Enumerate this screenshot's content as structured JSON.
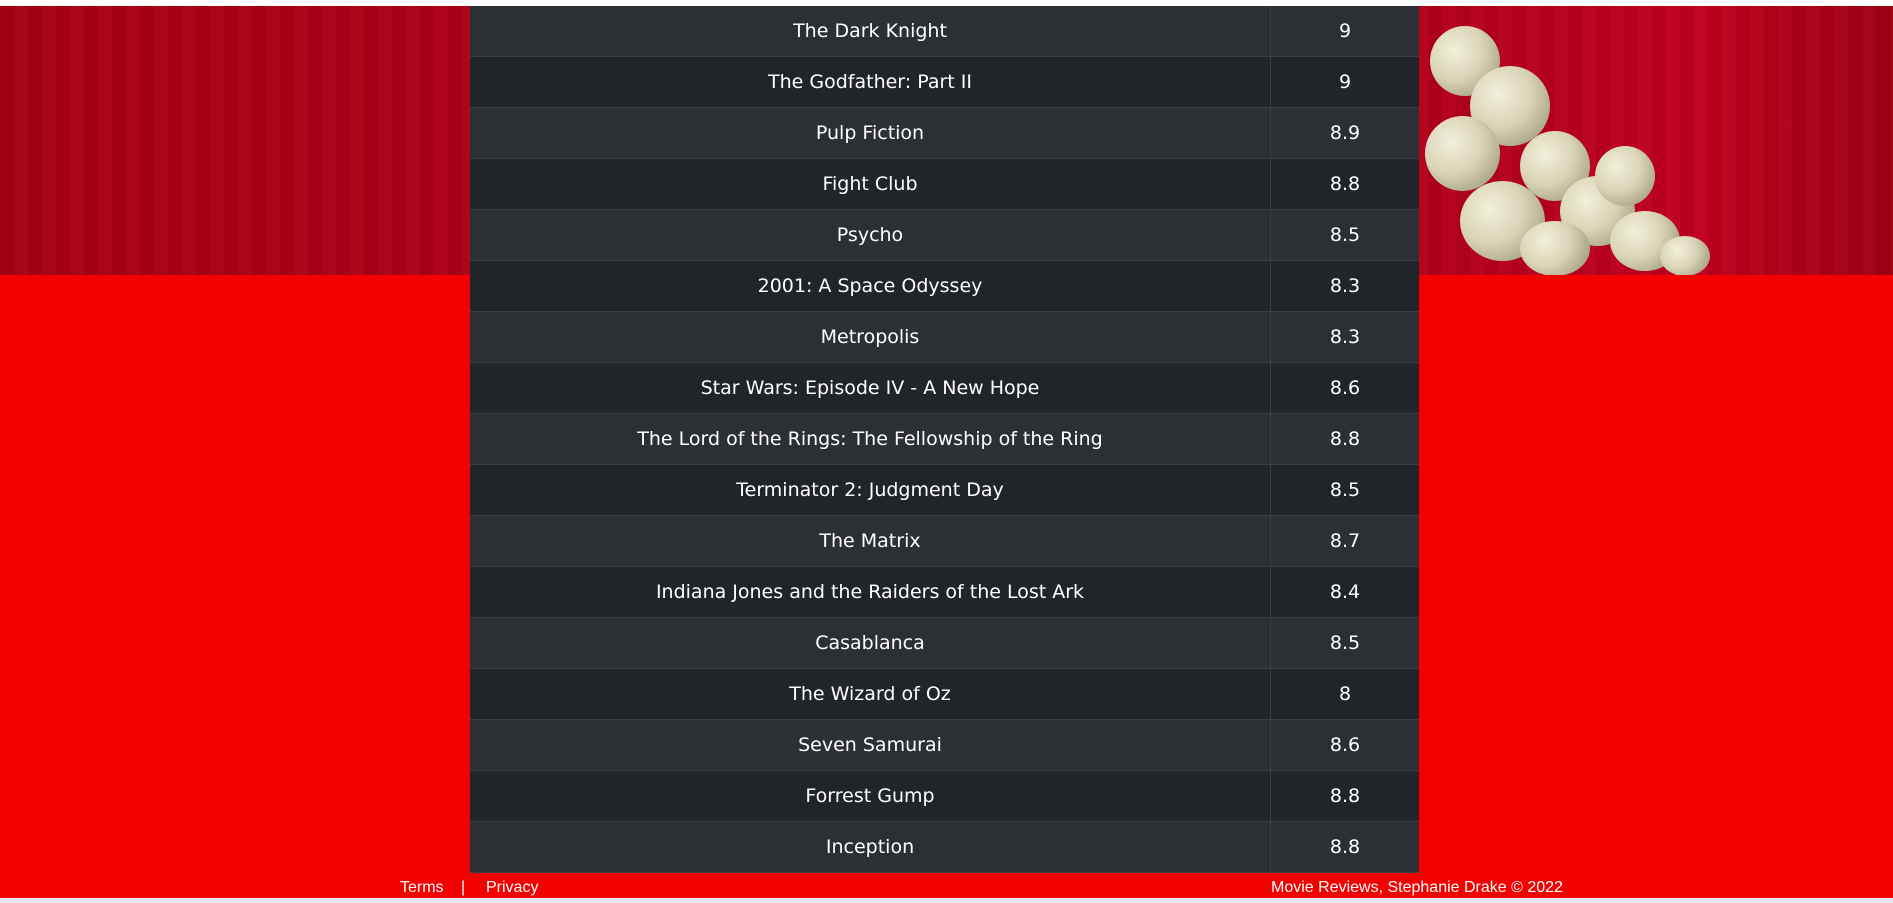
{
  "colors": {
    "page_background": "#f30000",
    "banner": "#a70013",
    "table_row_odd": "#2c3035",
    "table_row_even": "#212529",
    "text": "#ffffff"
  },
  "movies": [
    {
      "title": "The Dark Knight",
      "rating": "9"
    },
    {
      "title": "The Godfather: Part II",
      "rating": "9"
    },
    {
      "title": "Pulp Fiction",
      "rating": "8.9"
    },
    {
      "title": "Fight Club",
      "rating": "8.8"
    },
    {
      "title": "Psycho",
      "rating": "8.5"
    },
    {
      "title": "2001: A Space Odyssey",
      "rating": "8.3"
    },
    {
      "title": "Metropolis",
      "rating": "8.3"
    },
    {
      "title": "Star Wars: Episode IV - A New Hope",
      "rating": "8.6"
    },
    {
      "title": "The Lord of the Rings: The Fellowship of the Ring",
      "rating": "8.8"
    },
    {
      "title": "Terminator 2: Judgment Day",
      "rating": "8.5"
    },
    {
      "title": "The Matrix",
      "rating": "8.7"
    },
    {
      "title": "Indiana Jones and the Raiders of the Lost Ark",
      "rating": "8.4"
    },
    {
      "title": "Casablanca",
      "rating": "8.5"
    },
    {
      "title": "The Wizard of Oz",
      "rating": "8"
    },
    {
      "title": "Seven Samurai",
      "rating": "8.6"
    },
    {
      "title": "Forrest Gump",
      "rating": "8.8"
    },
    {
      "title": "Inception",
      "rating": "8.8"
    }
  ],
  "footer": {
    "terms_label": "Terms",
    "separator": "|",
    "privacy_label": "Privacy",
    "copyright": "Movie Reviews, Stephanie Drake © 2022"
  }
}
